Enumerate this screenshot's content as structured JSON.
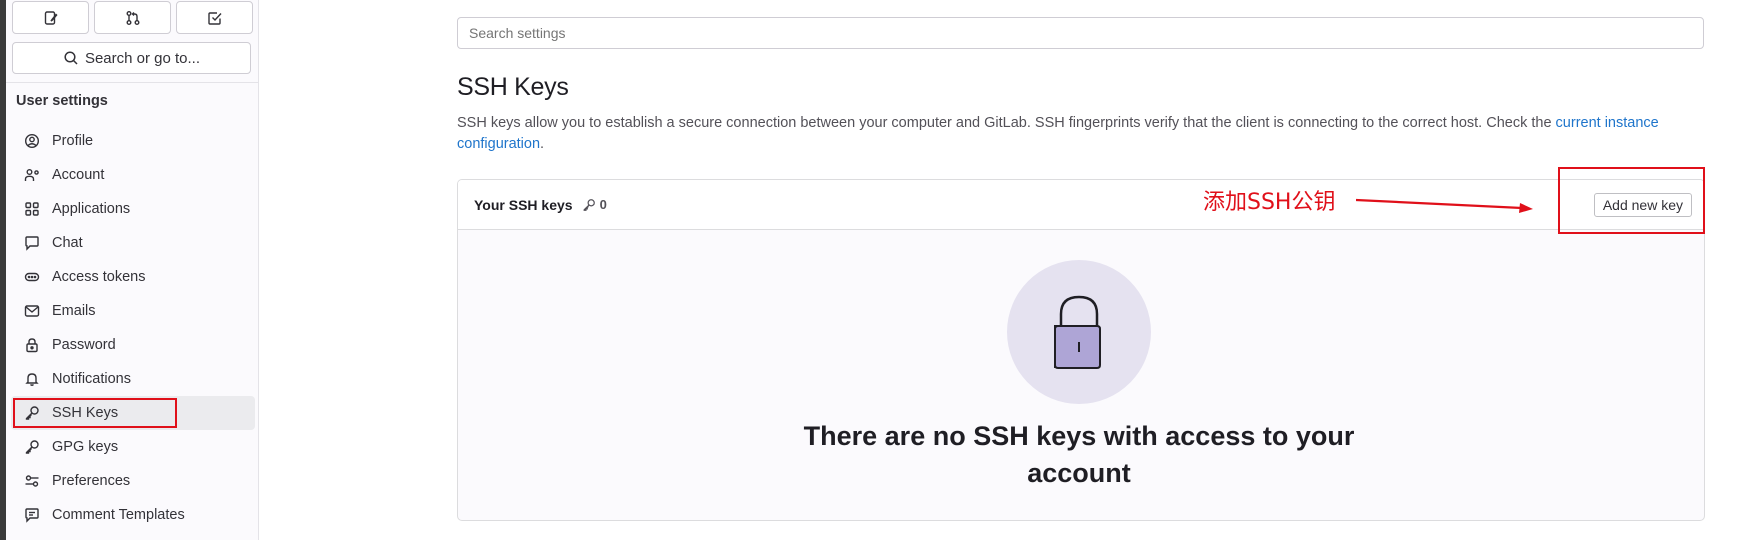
{
  "sidebar": {
    "top_buttons": [
      {
        "name": "issues-icon"
      },
      {
        "name": "merge-request-icon"
      },
      {
        "name": "todo-icon"
      }
    ],
    "search_label": "Search or go to...",
    "heading": "User settings",
    "items": [
      {
        "label": "Profile",
        "icon": "profile-icon"
      },
      {
        "label": "Account",
        "icon": "account-icon"
      },
      {
        "label": "Applications",
        "icon": "applications-icon"
      },
      {
        "label": "Chat",
        "icon": "chat-icon"
      },
      {
        "label": "Access tokens",
        "icon": "token-icon"
      },
      {
        "label": "Emails",
        "icon": "mail-icon"
      },
      {
        "label": "Password",
        "icon": "lock-icon"
      },
      {
        "label": "Notifications",
        "icon": "bell-icon"
      },
      {
        "label": "SSH Keys",
        "icon": "key-icon",
        "active": true
      },
      {
        "label": "GPG keys",
        "icon": "key-icon"
      },
      {
        "label": "Preferences",
        "icon": "preferences-icon"
      },
      {
        "label": "Comment Templates",
        "icon": "comment-icon"
      }
    ]
  },
  "main": {
    "search_placeholder": "Search settings",
    "title": "SSH Keys",
    "description_prefix": "SSH keys allow you to establish a secure connection between your computer and GitLab. SSH fingerprints verify that the client is connecting to the correct host. Check the ",
    "description_link": "current instance configuration",
    "description_suffix": ".",
    "card": {
      "title": "Your SSH keys",
      "count": "0",
      "add_button": "Add new key",
      "empty_message": "There are no SSH keys with access to your account"
    }
  },
  "annotation": {
    "text": "添加SSH公钥",
    "color": "#e0101a"
  },
  "colors": {
    "link": "#1f75cb",
    "illustration_bg": "#e5e2f0",
    "lock_body": "#aea5d6"
  }
}
